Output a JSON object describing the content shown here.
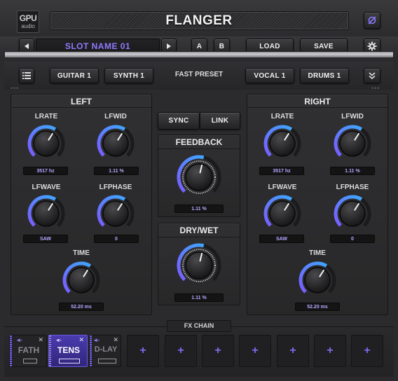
{
  "header": {
    "logo_line1": "GPU",
    "logo_line2": "audio",
    "title": "FLANGER",
    "bypass_icon": "power-slash-icon"
  },
  "preset_bar": {
    "prev_icon": "triangle-left-icon",
    "slot_name": "SLOT NAME 01",
    "next_icon": "triangle-right-icon",
    "a_label": "A",
    "b_label": "B",
    "load_label": "LOAD",
    "save_label": "SAVE",
    "settings_icon": "gear-icon"
  },
  "fast_preset": {
    "menu_icon": "list-icon",
    "label": "FAST PRESET",
    "buttons": [
      "GUITAR 1",
      "SYNTH 1",
      "VOCAL 1",
      "DRUMS 1"
    ],
    "expand_icon": "double-chevron-down-icon"
  },
  "left": {
    "title": "LEFT",
    "lrate_label": "LRATE",
    "lrate_value": "3517 hz",
    "lfwid_label": "LFWID",
    "lfwid_value": "1.11 %",
    "lfwave_label": "LFWAVE",
    "lfwave_value": "SAW",
    "lfphase_label": "LFPHASE",
    "lfphase_value": "0",
    "time_label": "TIME",
    "time_value": "52.20 ms"
  },
  "center": {
    "sync_label": "SYNC",
    "link_label": "LINK",
    "feedback_label": "FEEDBACK",
    "feedback_value": "1.11 %",
    "drywet_label": "DRY/WET",
    "drywet_value": "1.11 %"
  },
  "right": {
    "title": "RIGHT",
    "lrate_label": "LRATE",
    "lrate_value": "3517 hz",
    "lfwid_label": "LFWID",
    "lfwid_value": "1.11 %",
    "lfwave_label": "LFWAVE",
    "lfwave_value": "SAW",
    "lfphase_label": "LFPHASE",
    "lfphase_value": "0",
    "time_label": "TIME",
    "time_value": "52.20 ms"
  },
  "fx_chain": {
    "label": "FX CHAIN",
    "slots": [
      {
        "name": "FATH",
        "active": false
      },
      {
        "name": "TENS",
        "active": true
      },
      {
        "name": "D-LAY",
        "active": false
      }
    ],
    "empty_slot_label": "+",
    "empty_slot_count": 7
  },
  "colors": {
    "accent_purple": "#7a5cff",
    "accent_blue": "#3ea7ff",
    "value_text": "#b9a6ff",
    "fx_active_bg": "#3c2f8f"
  },
  "knob_levels": {
    "lrate": 0.62,
    "lfwid": 0.62,
    "lfwave": 0.62,
    "lfphase": 0.62,
    "time": 0.62,
    "feedback": 0.55,
    "drywet": 0.55
  }
}
